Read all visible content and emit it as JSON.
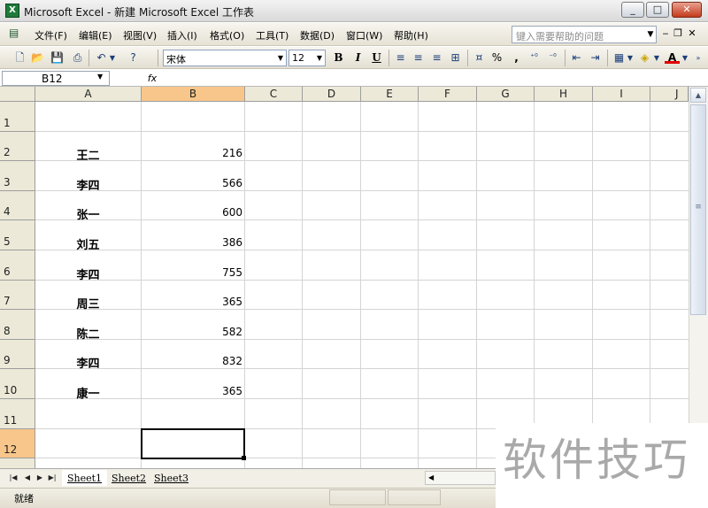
{
  "window": {
    "title": "Microsoft Excel - 新建 Microsoft Excel 工作表",
    "app_icon_label": "X",
    "min_label": "_",
    "max_label": "□",
    "close_label": "✕"
  },
  "menu": {
    "items": [
      "文件(F)",
      "编辑(E)",
      "视图(V)",
      "插入(I)",
      "格式(O)",
      "工具(T)",
      "数据(D)",
      "窗口(W)",
      "帮助(H)"
    ],
    "help_placeholder": "键入需要帮助的问题"
  },
  "toolbar": {
    "font_name": "宋体",
    "font_size": "12",
    "bold": "B",
    "italic": "I",
    "underline": "U",
    "percent": "%",
    "comma": ","
  },
  "formula_bar": {
    "name_box": "B12",
    "fx_label": "fx",
    "formula": ""
  },
  "sheet": {
    "columns": [
      "A",
      "B",
      "C",
      "D",
      "E",
      "F",
      "G",
      "H",
      "I",
      "J"
    ],
    "selected_column": "B",
    "rows": [
      "1",
      "2",
      "3",
      "4",
      "5",
      "6",
      "7",
      "8",
      "9",
      "10",
      "11",
      "12"
    ],
    "selected_row": "12",
    "selected_cell": "B12",
    "cells": [
      {
        "row": "2",
        "name": "王二",
        "value": "216"
      },
      {
        "row": "3",
        "name": "李四",
        "value": "566"
      },
      {
        "row": "4",
        "name": "张一",
        "value": "600"
      },
      {
        "row": "5",
        "name": "刘五",
        "value": "386"
      },
      {
        "row": "6",
        "name": "李四",
        "value": "755"
      },
      {
        "row": "7",
        "name": "周三",
        "value": "365"
      },
      {
        "row": "8",
        "name": "陈二",
        "value": "582"
      },
      {
        "row": "9",
        "name": "李四",
        "value": "832"
      },
      {
        "row": "10",
        "name": "康一",
        "value": "365"
      }
    ]
  },
  "tabs": {
    "sheets": [
      "Sheet1",
      "Sheet2",
      "Sheet3"
    ],
    "active": "Sheet1"
  },
  "status": {
    "text": "就绪"
  },
  "watermark": "软件技巧",
  "colors": {
    "header_bg": "#ece9d8",
    "header_selected": "#f8c68a",
    "grid_line": "#d4d4d4"
  }
}
